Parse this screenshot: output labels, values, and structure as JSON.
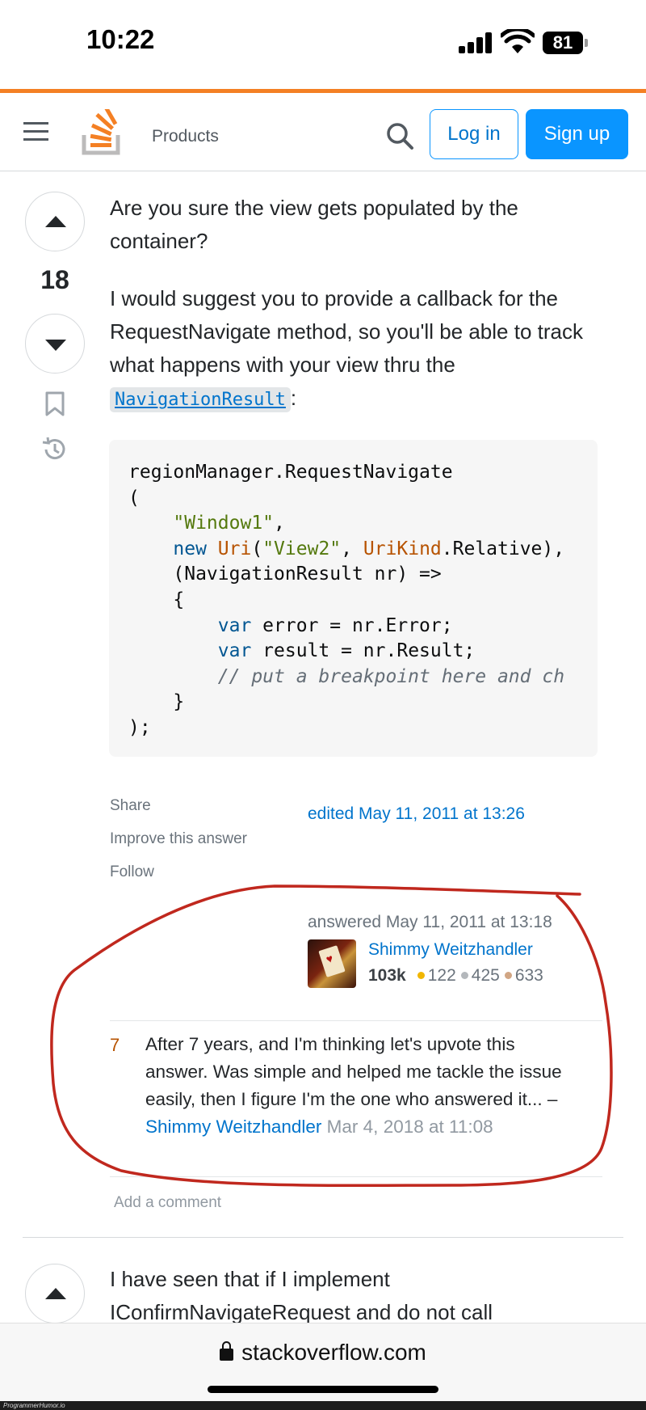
{
  "status_bar": {
    "time": "10:22",
    "battery": "81"
  },
  "nav": {
    "products": "Products",
    "login": "Log in",
    "signup": "Sign up"
  },
  "answer": {
    "score": "18",
    "question_text": "Are you sure the view gets populated by the container?",
    "suggestion_text": "I would suggest you to provide a callback for the RequestNavigate method, so you'll be able to track what happens with your view thru the",
    "inline_code": "NavigationResult",
    "colon": ":",
    "code_lines": [
      "regionManager.RequestNavigate",
      "(",
      "    \"Window1\",",
      "    new Uri(\"View2\", UriKind.Relative),",
      "    (NavigationResult nr) =>",
      "    {",
      "        var error = nr.Error;",
      "        var result = nr.Result;",
      "        // put a breakpoint here and ch",
      "    }",
      ");"
    ],
    "menu": {
      "share": "Share",
      "improve": "Improve this answer",
      "follow": "Follow"
    },
    "edited": "edited May 11, 2011 at 13:26",
    "answered": "answered May 11, 2011 at 13:18",
    "user": {
      "name": "Shimmy Weitzhandler",
      "reputation": "103k",
      "gold": "122",
      "silver": "425",
      "bronze": "633"
    }
  },
  "comment": {
    "score": "7",
    "text": "After 7 years, and I'm thinking let's upvote this answer. Was simple and helped me tackle the issue easily, then I figure I'm the one who answered it... – ",
    "user": "Shimmy Weitzhandler",
    "date": " Mar 4, 2018 at 11:08"
  },
  "add_comment": "Add a comment",
  "next_answer": {
    "text": "I have seen that if I implement IConfirmNavigateRequest and do not call"
  },
  "browser": {
    "url": "stackoverflow.com"
  },
  "watermark": "ProgrammerHumor.io",
  "colors": {
    "accent_orange": "#f48024",
    "link_blue": "#0074cc",
    "signup_blue": "#0a95ff",
    "annotation_red": "#c0281e",
    "gold": "#f1b600",
    "silver": "#b4b8bc",
    "bronze": "#d1a684"
  }
}
